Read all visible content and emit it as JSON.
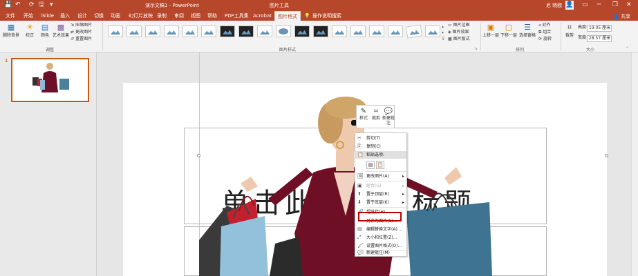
{
  "title_bar": {
    "quick_access": [
      "💾",
      "↶",
      "⟳",
      "🖫",
      "▾"
    ],
    "title": "演示文稿1 - PowerPoint",
    "context_tab_group": "图片工具",
    "user": "尼 晓欧",
    "window_controls": [
      "▭",
      "─",
      "❐",
      "✕"
    ]
  },
  "tabs": [
    "文件",
    "开始",
    "iSlide",
    "插入",
    "设计",
    "切换",
    "动画",
    "幻灯片放映",
    "录制",
    "审阅",
    "视图",
    "帮助",
    "PDF工具集",
    "Acrobat",
    "图片格式"
  ],
  "active_tab": "图片格式",
  "tell_me": "操作说明搜索",
  "share": "共享",
  "ribbon": {
    "adjust": {
      "remove_bg": "删除背景",
      "corrections": "校正",
      "color": "颜色",
      "artistic": "艺术效果",
      "compress": "压缩图片",
      "change": "更改图片",
      "reset": "重置图片",
      "label": "调整"
    },
    "styles": {
      "border": "图片边框",
      "effects": "图片效果",
      "layout": "图片版式",
      "label": "图片样式"
    },
    "arrange": {
      "forward": "上移一层",
      "backward": "下移一层",
      "selection_pane": "选择窗格",
      "align": "对齐",
      "group": "组合",
      "rotate": "旋转",
      "label": "排列"
    },
    "size": {
      "crop": "裁剪",
      "height_label": "高度:",
      "height": "19.05 厘米",
      "width_label": "宽度:",
      "width": "28.57 厘米",
      "label": "大小"
    }
  },
  "slide_panel": {
    "slide_number": "1"
  },
  "slide": {
    "placeholder_text": "单击此处添加标题"
  },
  "mini_toolbar": {
    "style": "样式",
    "crop": "裁剪",
    "comment": "新建批注"
  },
  "context_menu": [
    {
      "label": "剪切(T)",
      "icon": "✂"
    },
    {
      "label": "复制(C)",
      "icon": "⎘"
    },
    {
      "label": "粘贴选项:",
      "icon": "📋"
    },
    {
      "label": "更改图片(A)",
      "icon": "🖼"
    },
    {
      "label": "组合(G)",
      "icon": "▣"
    },
    {
      "label": "置于顶层(R)",
      "icon": "⬆"
    },
    {
      "label": "置于底层(K)",
      "icon": "⬇"
    },
    {
      "label": "超链接(H)...",
      "icon": "🔗"
    },
    {
      "label": "另存为图片(S)...",
      "icon": ""
    },
    {
      "label": "编辑替换文字(A)...",
      "icon": "▤"
    },
    {
      "label": "大小和位置(Z)...",
      "icon": "⤢"
    },
    {
      "label": "设置图片格式(O)...",
      "icon": "🖌"
    },
    {
      "label": "新建批注(M)",
      "icon": "💬"
    }
  ]
}
